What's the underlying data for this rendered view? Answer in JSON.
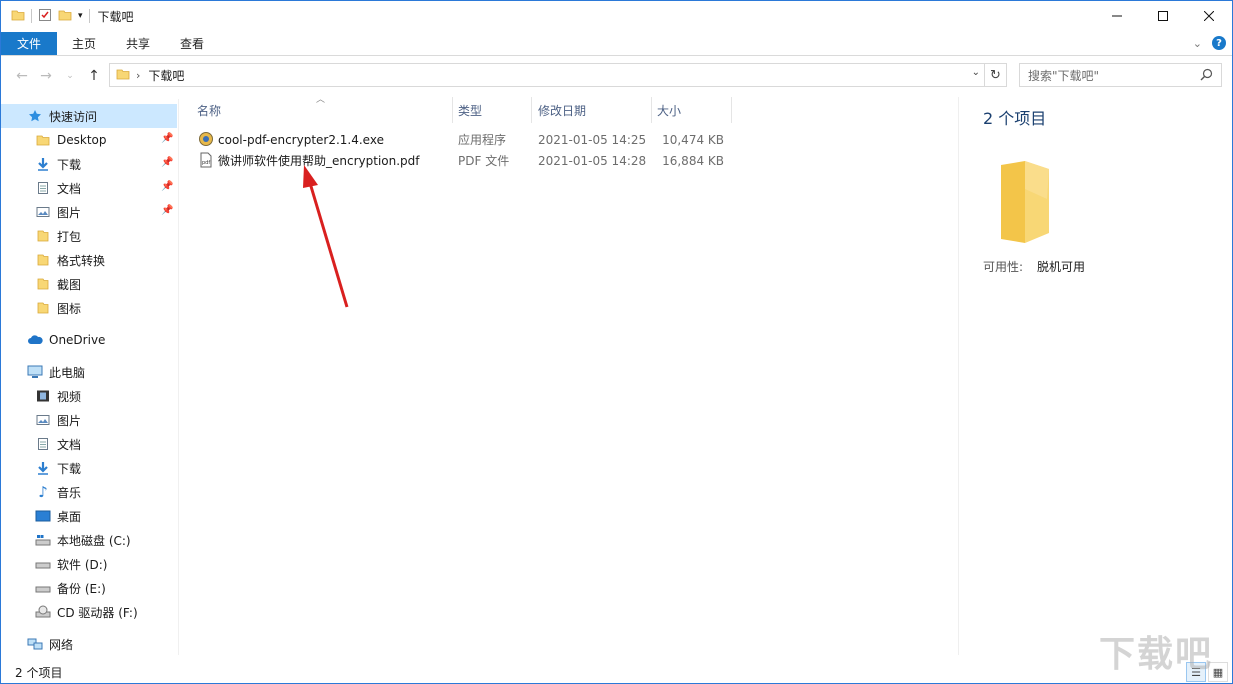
{
  "window": {
    "title": "下载吧"
  },
  "ribbon": {
    "tabs": [
      "文件",
      "主页",
      "共享",
      "查看"
    ]
  },
  "nav": {
    "breadcrumb": "下载吧",
    "search_placeholder": "搜索\"下载吧\""
  },
  "sidebar": {
    "quick_access": "快速访问",
    "quick_items": [
      {
        "label": "Desktop",
        "icon": "folder-blue-icon",
        "pinned": true
      },
      {
        "label": "下载",
        "icon": "download-icon",
        "pinned": true
      },
      {
        "label": "文档",
        "icon": "document-icon",
        "pinned": true
      },
      {
        "label": "图片",
        "icon": "picture-icon",
        "pinned": true
      },
      {
        "label": "打包",
        "icon": "folder-icon",
        "pinned": false
      },
      {
        "label": "格式转换",
        "icon": "folder-icon",
        "pinned": false
      },
      {
        "label": "截图",
        "icon": "folder-icon",
        "pinned": false
      },
      {
        "label": "图标",
        "icon": "folder-icon",
        "pinned": false
      }
    ],
    "onedrive": "OneDrive",
    "this_pc": "此电脑",
    "pc_items": [
      {
        "label": "视频",
        "icon": "video-icon"
      },
      {
        "label": "图片",
        "icon": "picture-icon"
      },
      {
        "label": "文档",
        "icon": "document-icon"
      },
      {
        "label": "下载",
        "icon": "download-icon"
      },
      {
        "label": "音乐",
        "icon": "music-icon"
      },
      {
        "label": "桌面",
        "icon": "desktop-icon"
      },
      {
        "label": "本地磁盘 (C:)",
        "icon": "system-drive-icon"
      },
      {
        "label": "软件 (D:)",
        "icon": "drive-icon"
      },
      {
        "label": "备份 (E:)",
        "icon": "drive-icon"
      },
      {
        "label": "CD 驱动器 (F:)",
        "icon": "cd-drive-icon"
      }
    ],
    "network": "网络"
  },
  "columns": {
    "name": "名称",
    "type": "类型",
    "date": "修改日期",
    "size": "大小"
  },
  "files": [
    {
      "name": "cool-pdf-encrypter2.1.4.exe",
      "type": "应用程序",
      "date": "2021-01-05 14:25",
      "size": "10,474 KB",
      "icon": "exe-icon"
    },
    {
      "name": "微讲师软件使用帮助_encryption.pdf",
      "type": "PDF 文件",
      "date": "2021-01-05 14:28",
      "size": "16,884 KB",
      "icon": "pdf-icon"
    }
  ],
  "details": {
    "count": "2 个项目",
    "availability_label": "可用性:",
    "availability_value": "脱机可用"
  },
  "status": {
    "count": "2 个项目"
  },
  "colors": {
    "accent": "#1979ca",
    "selection": "#cce8ff",
    "folder": "#f8d775",
    "arrow": "#d9201f"
  }
}
